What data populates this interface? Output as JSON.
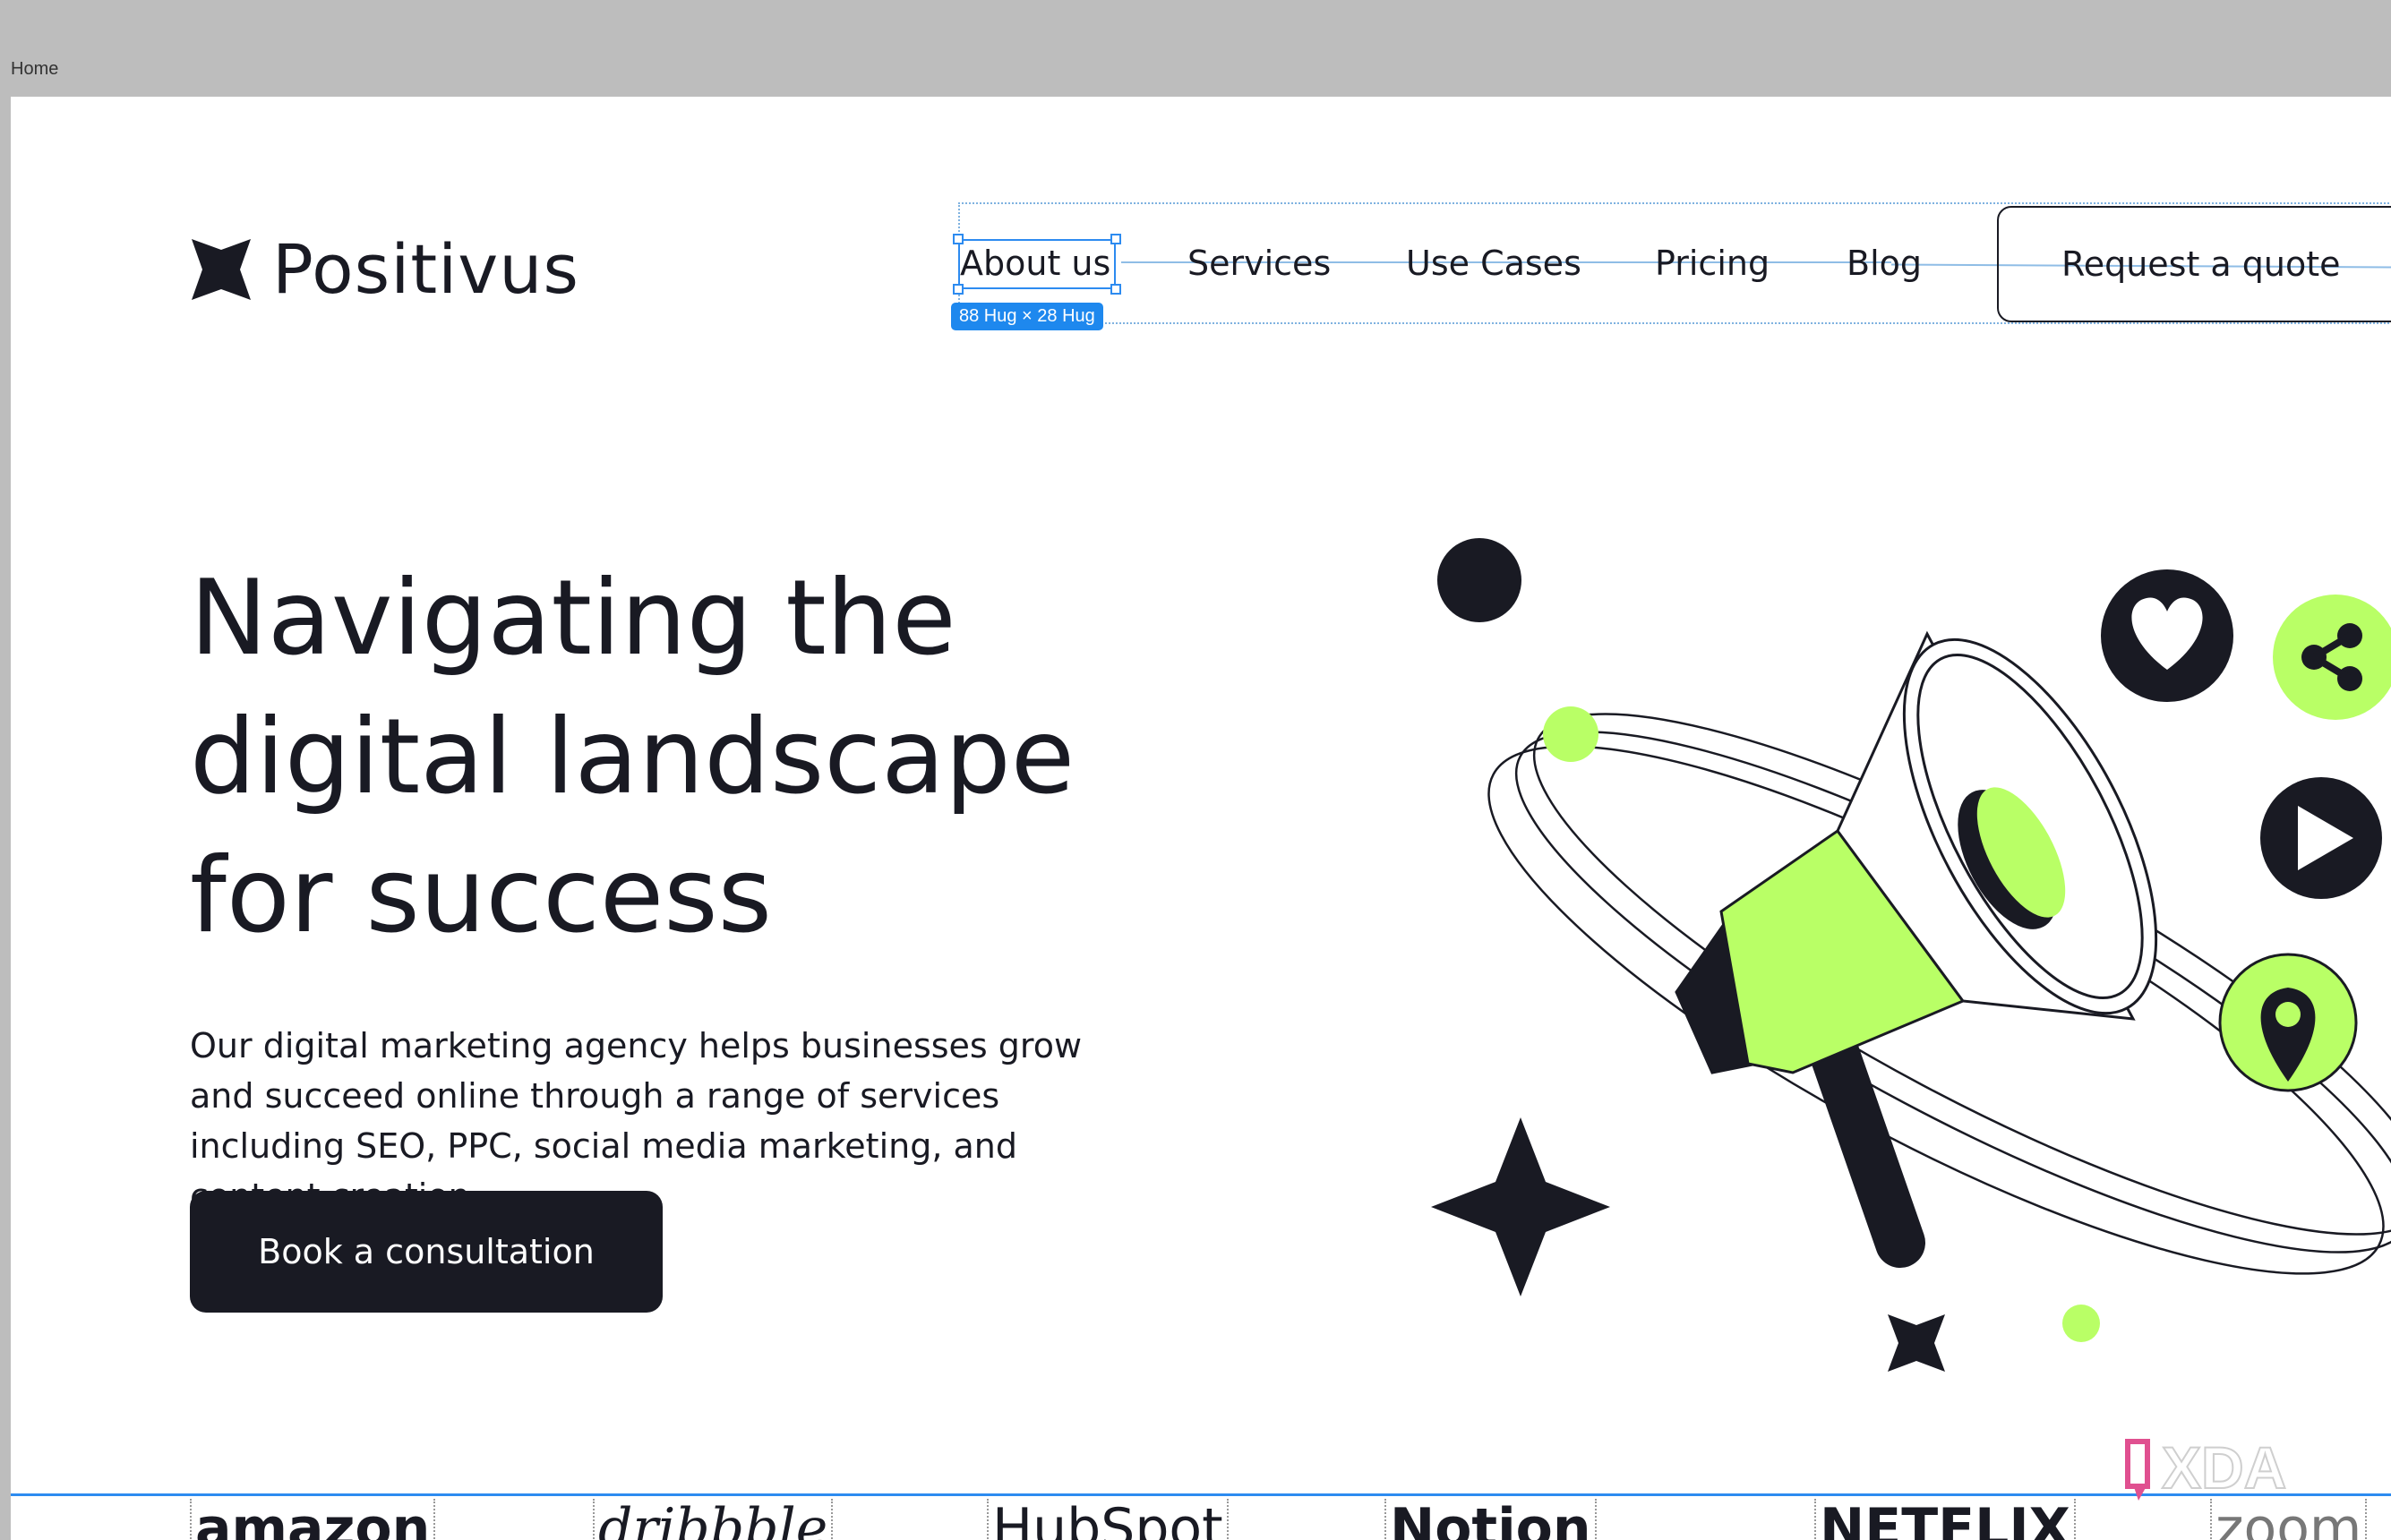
{
  "frame": {
    "label": "Home"
  },
  "brand": {
    "name": "Positivus"
  },
  "nav": {
    "items": [
      "About us",
      "Services",
      "Use Cases",
      "Pricing",
      "Blog"
    ],
    "cta": "Request a quote",
    "selection_badge": "88 Hug × 28 Hug"
  },
  "hero": {
    "title": "Navigating the digital landscape for success",
    "description": "Our digital marketing agency helps businesses grow and succeed online through a range of services including SEO, PPC, social media marketing, and content creation.",
    "cta": "Book a consultation"
  },
  "logos": [
    "amazon",
    "dribbble",
    "HubSpot",
    "Notion",
    "NETFLIX",
    "zoom"
  ],
  "watermark": "XDA",
  "colors": {
    "accent": "#b9ff66",
    "dark": "#191a23",
    "selection": "#2d8bf0"
  }
}
